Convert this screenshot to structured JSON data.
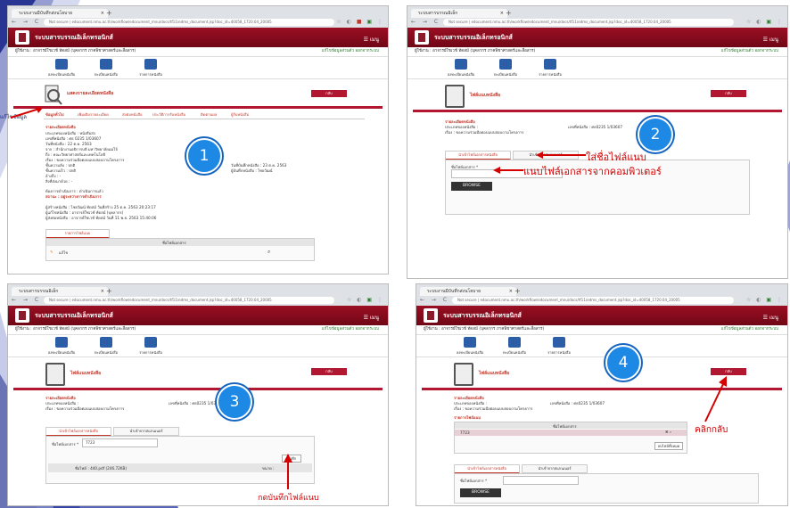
{
  "colors": {
    "accent": "#b11730",
    "annotation": "#d50000",
    "step_circle": "#1e88e5",
    "nav_bg": "#1a237e"
  },
  "browser": {
    "tab_title": "ระบบงานมีบันทึกส่งนโยบาย",
    "tab_title_short": "ระบบสารบรรณอิเล็ก",
    "new_tab": "+",
    "close": "×",
    "nav": "← → C",
    "url": "Not secure | edocument.nmu.ac.th/workflow/edocument_mnu/docs/tf11/edms_document.jsp?doc_id=40058_1720.04_20005"
  },
  "app": {
    "banner_title": "ระบบสารบรรณอิเล็กทรอนิกส์",
    "hamburger": "☰ เมนู",
    "user_label": "ผู้ใช้งาน : อาจารย์ใชเวช์ ทัดสม์ (บุคลากร ภาคพิชาศาสตร์และสื่อสาร)",
    "user_links": "แก้ไขข้อมูลส่วนตัว  ออกจากระบบ",
    "menu": [
      {
        "label": "ลงทะเบียนหนังสือ"
      },
      {
        "label": "ทะเบียนหนังสือ"
      },
      {
        "label": "รายการหนังสือ"
      }
    ]
  },
  "panel1": {
    "page_title": "แสดงรายละเอียดหนังสือ",
    "back": "กลับ",
    "tabs": [
      "ข้อมูลทั่วไป",
      "เพิ่มเติมรายละเอียด",
      "ส่งต่อหนังสือ",
      "ประวัติการรับหนังสือ",
      "ติดตามผล",
      "ผู้รับหนังสือ"
    ],
    "section": "รายละเอียดหนังสือ",
    "fields": [
      "ประเภทของหนังสือ : หนังสือส่ง",
      "เลขที่หนังสือ : ศธ 0235 1/03607",
      "วันที่หนังสือ : 22 ต.ค. 2563",
      "จาก : สำนักงานอธิการบดี มหาวิทยาลัยแม่โจ้",
      "ถึง : คณะวิทยาศาสตร์และเทคโนโลยี",
      "เรื่อง : ขอความร่วมมือตอบแบบสอบถามโครงการ",
      "ชั้นความลับ : ปกติ",
      "ชั้นความเร็ว : ปกติ",
      "อ้างถึง : -",
      "สิ่งที่ส่งมาด้วย : -"
    ],
    "right_fields": [
      "วันที่บันทึกหนังสือ : 23 ต.ค. 2563",
      "ผู้บันทึกหนังสือ : ไชยวัฒน์"
    ],
    "status": "ต้องการดำเนินการ : ดำเนินการแล้ว",
    "note": "สถานะ : อยู่ระหว่างการดำเนินการ",
    "history": [
      "ผู้สร้างหนังสือ : ไชยวัฒน์ ทัดสม์ วันที่สร้าง 25 ต.ค. 2563 20:23:17",
      "ผู้แก้ไขหนังสือ : อาจารย์ใชเวช์ ทัดสม์ (บุคลากร)",
      "ผู้ส่งต่อหนังสือ : อาจารย์ใชเวช์ ทัดสม์ วันที่ 11 พ.ย. 2563 15:40:06"
    ],
    "attach_tab": "รายการไฟล์แนบ",
    "attach_header": "ชื่อไฟล์เอกสาร",
    "attach_row": "แก้ไข",
    "left_label": "แก้ไขข้อมูล"
  },
  "panel2": {
    "page_title": "ไฟล์แนบหนังสือ",
    "back": "กลับ",
    "section": "รายละเอียดหนังสือ",
    "fields": [
      "ประเภทของหนังสือ :",
      "เรื่อง : ขอความร่วมมือตอบแบบสอบถามโครงการ"
    ],
    "right_field": "เลขที่หนังสือ : ศธ0235 1/03607",
    "tab1": "นำเข้าไฟล์เอกสารหนังสือ",
    "tab2": "นำเข้าจากสแกนเนอร์",
    "name_label": "ชื่อไฟล์เอกสาร *",
    "browse": "BROWSE",
    "anno1": "ใส่ชื่อไฟล์แนบ",
    "anno2": "แนบไฟล์เอกสารจากคอมพิวเตอร์"
  },
  "panel3": {
    "page_title": "ไฟล์แนบหนังสือ",
    "back": "กลับ",
    "name_value": "7723",
    "file_label": "ชื่อไฟล์ : 440.pdf (246.72KB)",
    "file_right": "ขนาด :",
    "save": "บันทึก",
    "anno": "กดบันทึกไฟล์แนบ"
  },
  "panel4": {
    "page_title": "ไฟล์แนบหนังสือ",
    "back": "กลับ",
    "list_title": "รายการไฟล์แนบ",
    "list_header": "ชื่อไฟล์เอกสาร",
    "list_row": "7723",
    "delete_all": "ลบไฟล์ทั้งหมด",
    "anno": "คลิกกลับ",
    "browse": "BROWSE"
  },
  "steps": [
    "1",
    "2",
    "3",
    "4"
  ]
}
